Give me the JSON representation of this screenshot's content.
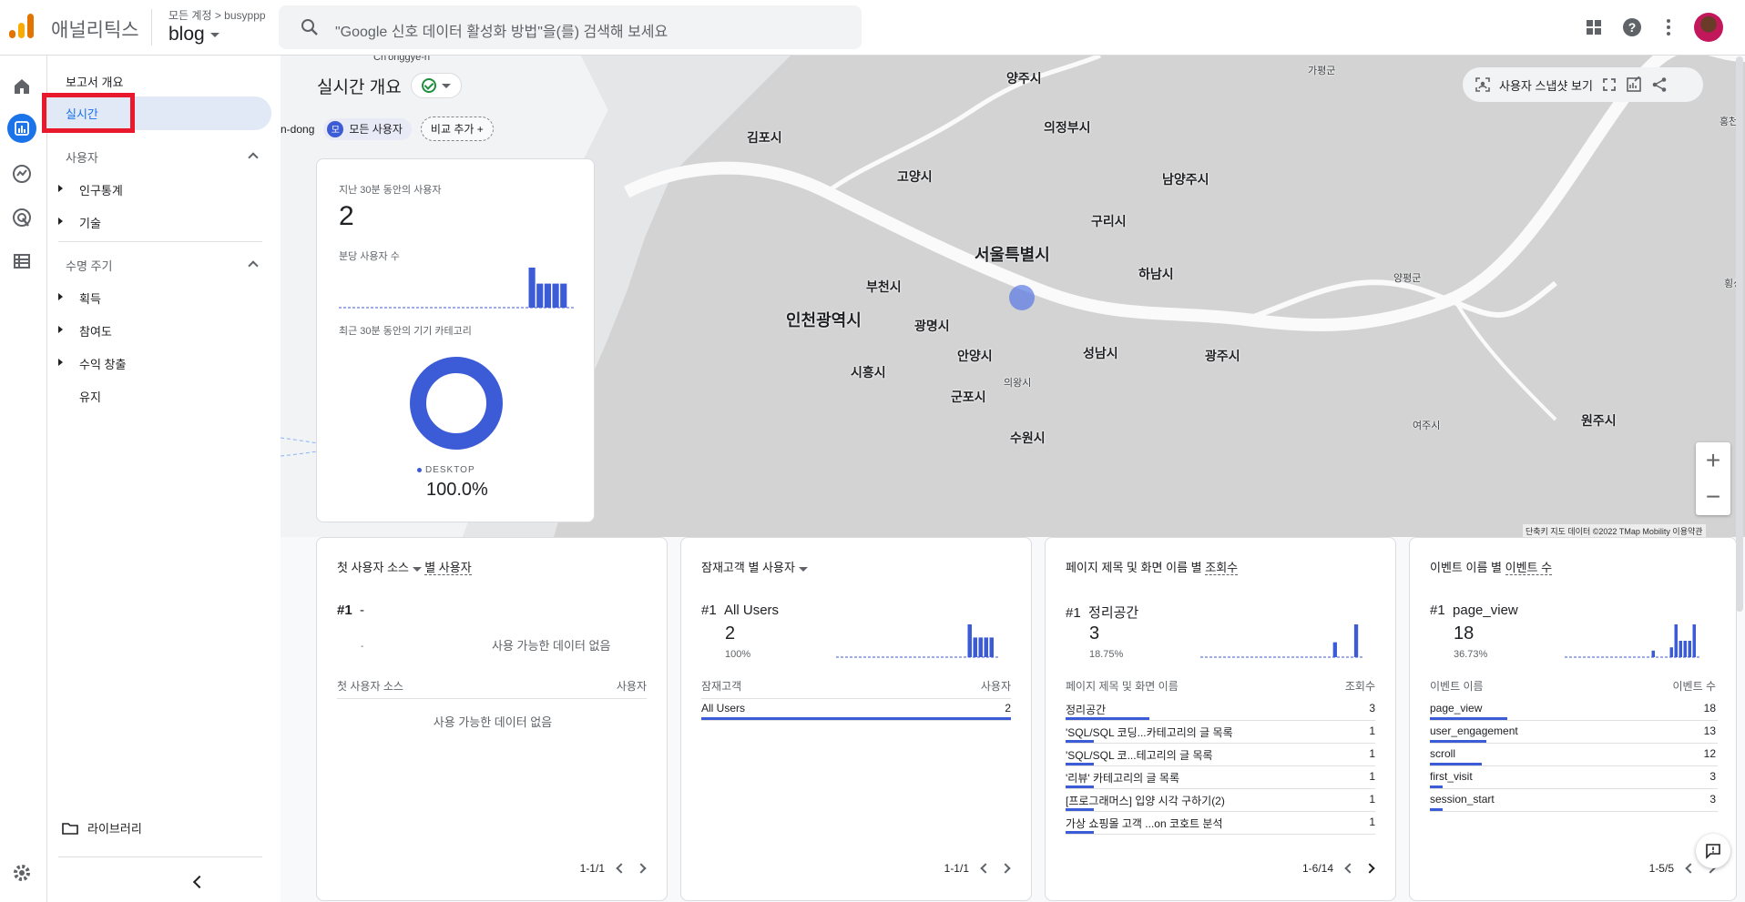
{
  "header": {
    "app_name": "애널리틱스",
    "account_path": "모든 계정 > busyppp",
    "property": "blog",
    "search_placeholder": "\"Google 신호 데이터 활성화 방법\"을(를) 검색해 보세요"
  },
  "nav": {
    "overview": "보고서 개요",
    "realtime": "실시간",
    "section_users": "사용자",
    "demographics": "인구통계",
    "tech": "기술",
    "section_lifecycle": "수명 주기",
    "acquisition": "획득",
    "engagement": "참여도",
    "monetization": "수익 창출",
    "retention": "유지",
    "library": "라이브러리"
  },
  "page": {
    "title": "실시간 개요",
    "map_fragment": "n-dong",
    "chip_all": "모든 사용자",
    "chip_all_initial": "모",
    "chip_add": "비교 추가",
    "snapshot": "사용자 스냅샷 보기"
  },
  "map": {
    "cities": {
      "yangju": "양주시",
      "gapyeong": "가평군",
      "uijeongbu": "의정부시",
      "gimpo": "김포시",
      "goyang": "고양시",
      "namyangju": "남양주시",
      "guri": "구리시",
      "seoul": "서울특별시",
      "bucheon": "부천시",
      "hanam": "하남시",
      "yangpyeong": "양평군",
      "incheon": "인천광역시",
      "gwangmyeong": "광명시",
      "anyang": "안양시",
      "seongnam": "성남시",
      "gwangju": "광주시",
      "siheung": "시흥시",
      "uiwang": "의왕시",
      "gunpo": "군포시",
      "yeoju": "여주시",
      "wonju": "원주시",
      "suwon": "수원시",
      "chonggye": "Ch'onggye-ri",
      "hong": "홍천",
      "hoeng": "횡성"
    },
    "attribution": "단축키   지도 데이터 ©2022 TMap Mobility   이용약관"
  },
  "summary_card": {
    "users_label": "지난 30분 동안의 사용자",
    "users_value": "2",
    "per_min_label": "분당 사용자 수",
    "device_label": "최근 30분 동안의 기기 카테고리",
    "device_name": "DESKTOP",
    "device_pct": "100.0%",
    "per_minute": [
      0,
      0,
      0,
      0,
      0,
      0,
      0,
      0,
      0,
      0,
      0,
      0,
      0,
      0,
      0,
      0,
      0,
      0,
      0,
      0,
      0,
      0,
      0,
      0,
      2,
      1.2,
      1.2,
      1.2,
      1.2,
      0
    ]
  },
  "card_source": {
    "title_a": "첫 사용자 소스",
    "title_b": "별 사용자",
    "rank": "#1",
    "rank_name": "-",
    "dash": "-",
    "empty_top": "사용 가능한 데이터 없음",
    "col_left": "첫 사용자 소스",
    "col_right": "사용자",
    "empty": "사용 가능한 데이터 없음",
    "pager": "1-1/1"
  },
  "card_audience": {
    "title_a": "잠재고객 별 사용자",
    "rank": "#1",
    "rank_name": "All Users",
    "value": "2",
    "pct": "100%",
    "col_left": "잠재고객",
    "col_right": "사용자",
    "rows": [
      {
        "name": "All Users",
        "value": "2"
      }
    ],
    "pager": "1-1/1",
    "spark": [
      0,
      0,
      0,
      0,
      0,
      0,
      0,
      0,
      0,
      0,
      0,
      0,
      0,
      0,
      0,
      0,
      0,
      0,
      0,
      0,
      0,
      0,
      0,
      0,
      2,
      1.2,
      1.2,
      1.2,
      1.2,
      0
    ]
  },
  "card_pages": {
    "title_a": "페이지 제목 및 화면 이름 별",
    "title_b": "조회수",
    "rank": "#1",
    "rank_name": "정리공간",
    "value": "3",
    "pct": "18.75%",
    "col_left": "페이지 제목 및 화면 이름",
    "col_right": "조회수",
    "rows": [
      {
        "name": "정리공간",
        "value": "3"
      },
      {
        "name": "'SQL/SQL 코딩...카테고리의 글 목록",
        "value": "1"
      },
      {
        "name": "'SQL/SQL 코...테고리의 글 목록",
        "value": "1"
      },
      {
        "name": "'리뷰' 카테고리의 글 목록",
        "value": "1"
      },
      {
        "name": "[프로그래머스] 입양 시각 구하기(2)",
        "value": "1"
      },
      {
        "name": "가상 쇼핑몰 고객 ...on 코호트 분석",
        "value": "1"
      }
    ],
    "pager": "1-6/14",
    "spark": [
      0,
      0,
      0,
      0,
      0,
      0,
      0,
      0,
      0,
      0,
      0,
      0,
      0,
      0,
      0,
      0,
      0,
      0,
      0,
      0,
      0,
      0,
      0,
      0,
      0,
      1,
      0,
      0,
      0,
      2.2,
      0
    ]
  },
  "card_events": {
    "title_a": "이벤트 이름 별",
    "title_b": "이벤트 수",
    "rank": "#1",
    "rank_name": "page_view",
    "value": "18",
    "pct": "36.73%",
    "col_left": "이벤트 이름",
    "col_right": "이벤트 수",
    "rows": [
      {
        "name": "page_view",
        "value": "18"
      },
      {
        "name": "user_engagement",
        "value": "13"
      },
      {
        "name": "scroll",
        "value": "12"
      },
      {
        "name": "first_visit",
        "value": "3"
      },
      {
        "name": "session_start",
        "value": "3"
      }
    ],
    "pager": "1-5/5",
    "spark": [
      0,
      0,
      0,
      0,
      0,
      0,
      0,
      0,
      0,
      0,
      0,
      0,
      0,
      0,
      0,
      0,
      0,
      0,
      0,
      0.4,
      0,
      0,
      0,
      0.6,
      2,
      1,
      1,
      1,
      2,
      0
    ]
  },
  "colors": {
    "accent": "#1a73e8",
    "series": "#3c5bd6",
    "highlight_box": "#e8192c"
  }
}
